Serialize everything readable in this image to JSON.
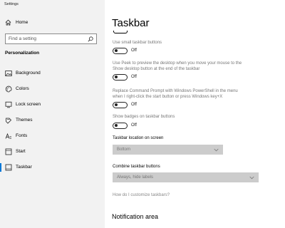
{
  "window": {
    "title": "Settings"
  },
  "sidebar": {
    "home_label": "Home",
    "search_placeholder": "Find a setting",
    "section_header": "Personalization",
    "items": [
      {
        "label": "Background",
        "icon": "picture-icon"
      },
      {
        "label": "Colors",
        "icon": "palette-icon"
      },
      {
        "label": "Lock screen",
        "icon": "lock-screen-icon"
      },
      {
        "label": "Themes",
        "icon": "themes-icon"
      },
      {
        "label": "Fonts",
        "icon": "fonts-icon"
      },
      {
        "label": "Start",
        "icon": "start-icon"
      },
      {
        "label": "Taskbar",
        "icon": "taskbar-icon",
        "selected": true
      }
    ]
  },
  "main": {
    "title": "Taskbar",
    "settings": [
      {
        "label": "Use small taskbar buttons",
        "state": "Off"
      },
      {
        "label_line1": "Use Peek to preview the desktop when you move your mouse to the",
        "label_line2": "Show desktop button at the end of the taskbar",
        "state": "Off"
      },
      {
        "label_line1": "Replace Command Prompt with Windows PowerShell in the menu",
        "label_line2": "when I right-click the start button or press Windows key+X",
        "state": "Off"
      },
      {
        "label": "Show badges on taskbar buttons",
        "state": "Off"
      }
    ],
    "location": {
      "label": "Taskbar location on screen",
      "value": "Bottom"
    },
    "combine": {
      "label": "Combine taskbar buttons",
      "value": "Always, hide labels"
    },
    "help_link": "How do I customize taskbars?",
    "next_section": "Notification area"
  },
  "colors": {
    "accent": "#0078d7",
    "sidebar_bg": "#f2f2f2",
    "dropdown_bg": "#cccccc"
  }
}
